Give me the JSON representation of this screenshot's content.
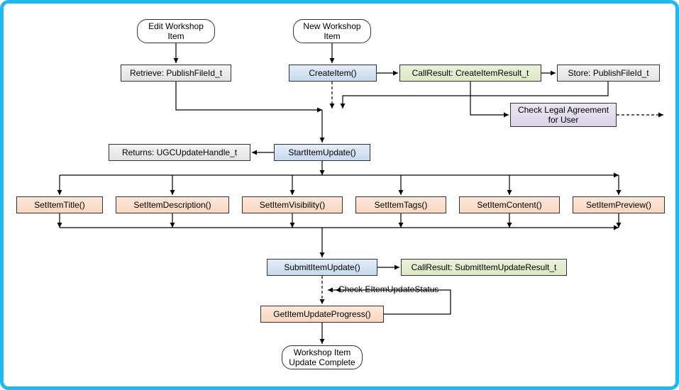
{
  "start": {
    "edit": "Edit Workshop Item",
    "new": "New Workshop Item"
  },
  "retrieve": "Retrieve: PublishFileId_t",
  "createItem": "CreateItem()",
  "createResult": "CallResult: CreateItemResult_t",
  "store": "Store: PublishFileId_t",
  "legal": "Check Legal Agreement for User",
  "returnsHandle": "Returns: UGCUpdateHandle_t",
  "startUpdate": "StartItemUpdate()",
  "setters": {
    "title": "SetItemTitle()",
    "desc": "SetItemDescription()",
    "vis": "SetItemVisibility()",
    "tags": "SetItemTags()",
    "content": "SetItemContent()",
    "preview": "SetItemPreview()"
  },
  "submit": "SubmitItemUpdate()",
  "submitResult": "CallResult: SubmitItemUpdateResult_t",
  "checkStatus": "Check EItemUpdateStatus",
  "progress": "GetItemUpdateProgress()",
  "end": "Workshop Item Update Complete"
}
